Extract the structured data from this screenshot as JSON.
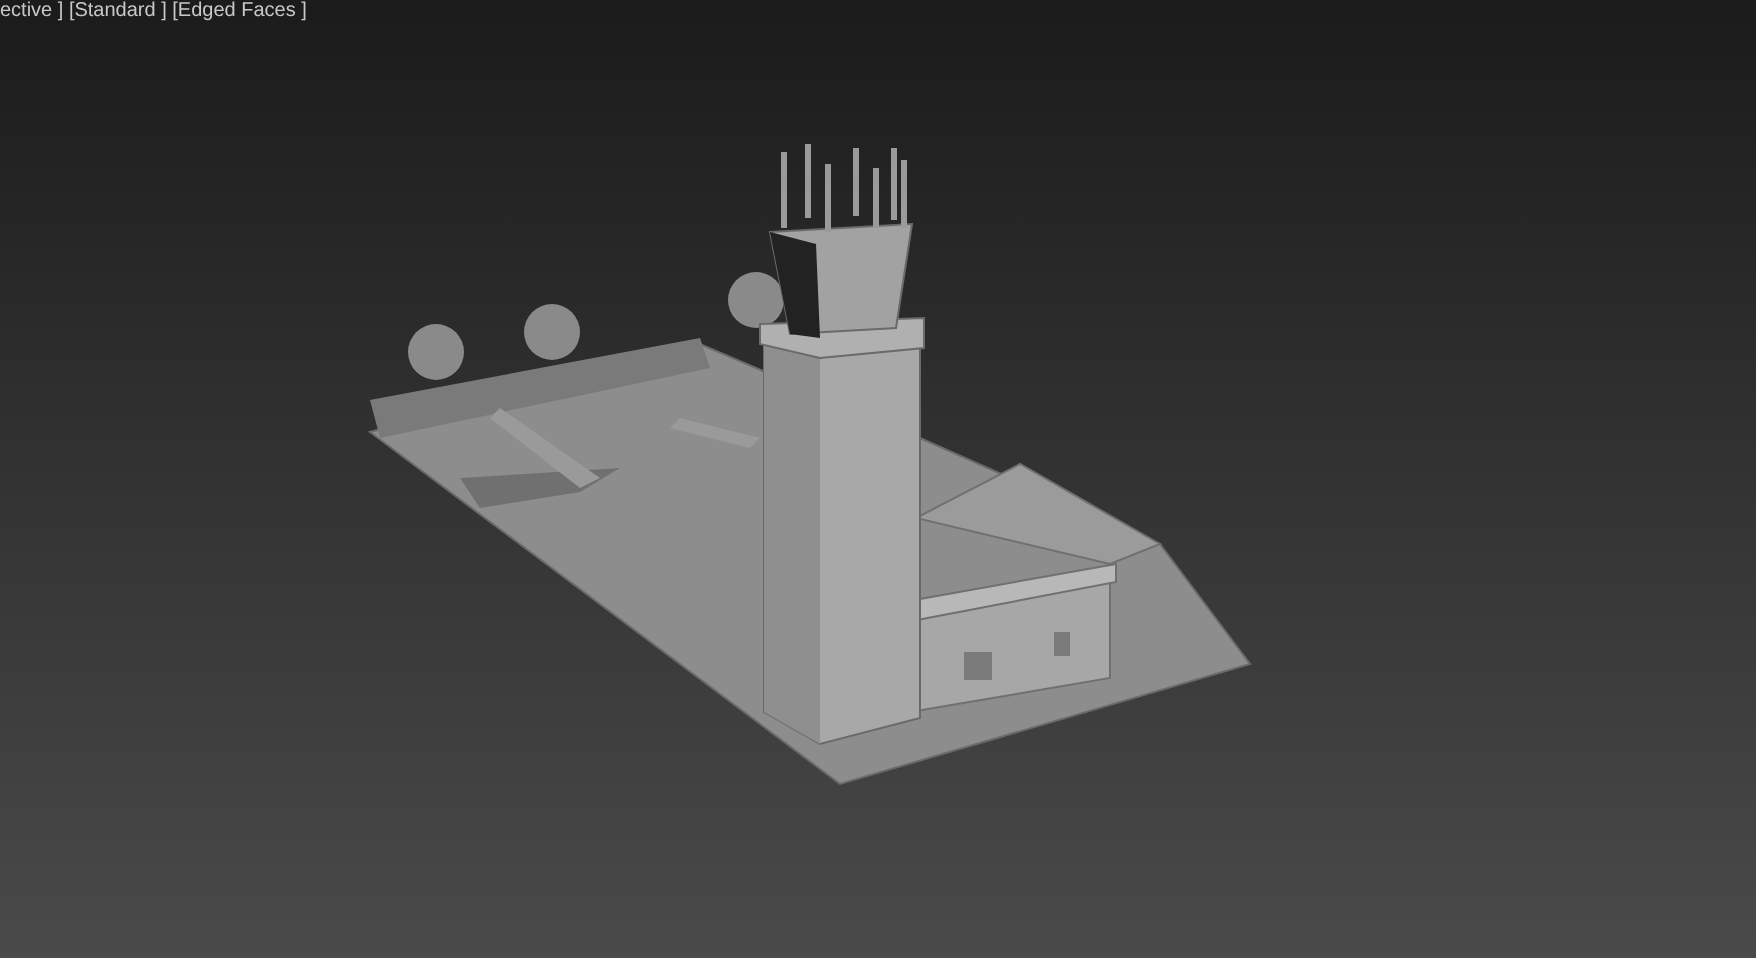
{
  "viewport": {
    "label": "ective ] [Standard ] [Edged Faces ]"
  }
}
